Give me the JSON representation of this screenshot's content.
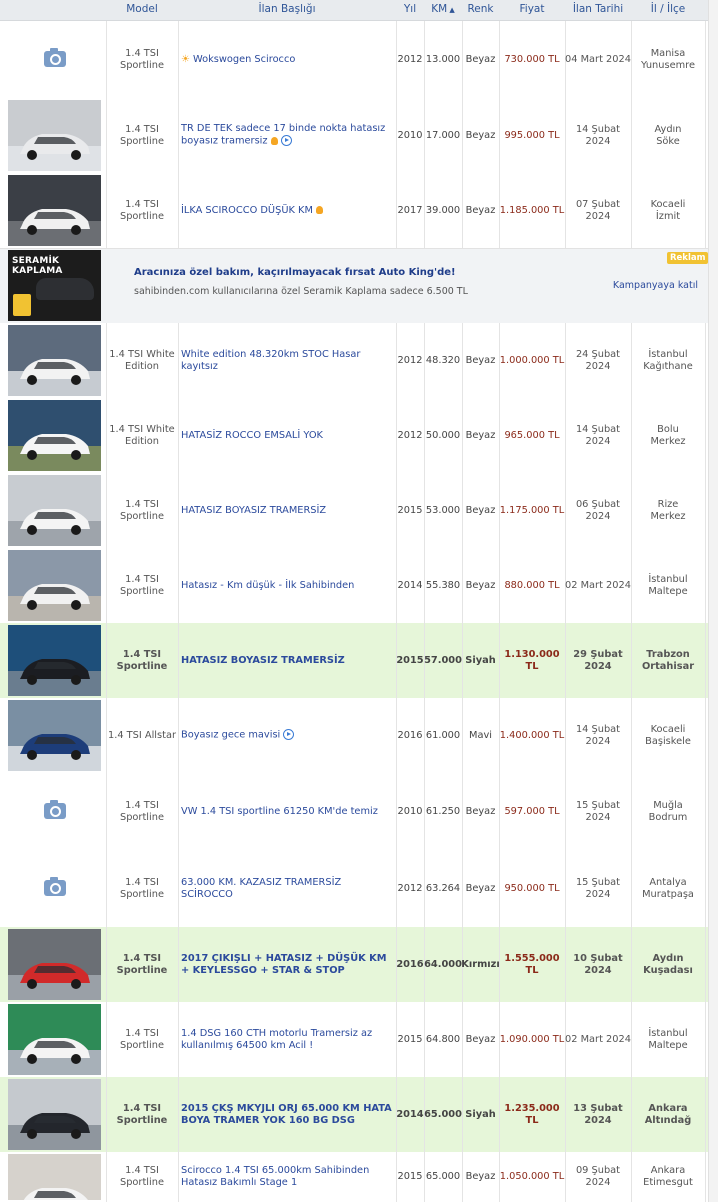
{
  "header": {
    "model": "Model",
    "title": "İlan Başlığı",
    "year": "Yıl",
    "km": "KM",
    "color": "Renk",
    "price": "Fiyat",
    "date": "İlan Tarihi",
    "location": "İl / İlçe"
  },
  "ad": {
    "image_text": "SERAMİK KAPLAMA",
    "title": "Aracınıza özel bakım, kaçırılmayacak fırsat Auto King'de!",
    "subtitle": "sahibinden.com kullanıcılarına özel Seramik Kaplama sadece 6.500 TL",
    "badge": "Reklam",
    "link": "Kampanyaya katıl"
  },
  "listings": [
    {
      "model": "1.4 TSI Sportline",
      "title": "Wokswogen Scirocco",
      "year": "2012",
      "km": "13.000",
      "color": "Beyaz",
      "price": "730.000 TL",
      "date": "04 Mart 2024",
      "city": "Manisa",
      "district": "Yunusemre"
    },
    {
      "model": "1.4 TSI Sportline",
      "title": "TR DE TEK sadece 17 binde nokta hatasız boyasız tramersiz",
      "year": "2010",
      "km": "17.000",
      "color": "Beyaz",
      "price": "995.000 TL",
      "date": "14 Şubat 2024",
      "city": "Aydın",
      "district": "Söke"
    },
    {
      "model": "1.4 TSI Sportline",
      "title": "İLKA SCIROCCO DÜŞÜK KM",
      "year": "2017",
      "km": "39.000",
      "color": "Beyaz",
      "price": "1.185.000 TL",
      "date": "07 Şubat 2024",
      "city": "Kocaeli",
      "district": "İzmit"
    },
    {
      "model": "1.4 TSI White Edition",
      "title": "White edition 48.320km STOC Hasar kayıtsız",
      "year": "2012",
      "km": "48.320",
      "color": "Beyaz",
      "price": "1.000.000 TL",
      "date": "24 Şubat 2024",
      "city": "İstanbul",
      "district": "Kağıthane"
    },
    {
      "model": "1.4 TSI White Edition",
      "title": "HATASİZ ROCCO EMSALİ YOK",
      "year": "2012",
      "km": "50.000",
      "color": "Beyaz",
      "price": "965.000 TL",
      "date": "14 Şubat 2024",
      "city": "Bolu",
      "district": "Merkez"
    },
    {
      "model": "1.4 TSI Sportline",
      "title": "HATASIZ BOYASIZ TRAMERSİZ",
      "year": "2015",
      "km": "53.000",
      "color": "Beyaz",
      "price": "1.175.000 TL",
      "date": "06 Şubat 2024",
      "city": "Rize",
      "district": "Merkez"
    },
    {
      "model": "1.4 TSI Sportline",
      "title": "Hatasız - Km düşük - İlk Sahibinden",
      "year": "2014",
      "km": "55.380",
      "color": "Beyaz",
      "price": "880.000 TL",
      "date": "02 Mart 2024",
      "city": "İstanbul",
      "district": "Maltepe"
    },
    {
      "model": "1.4 TSI Sportline",
      "title": "HATASIZ BOYASIZ TRAMERSİZ",
      "year": "2015",
      "km": "57.000",
      "color": "Siyah",
      "price": "1.130.000 TL",
      "date": "29 Şubat 2024",
      "city": "Trabzon",
      "district": "Ortahisar"
    },
    {
      "model": "1.4 TSI Allstar",
      "title": "Boyasız gece mavisi",
      "year": "2016",
      "km": "61.000",
      "color": "Mavi",
      "price": "1.400.000 TL",
      "date": "14 Şubat 2024",
      "city": "Kocaeli",
      "district": "Başiskele"
    },
    {
      "model": "1.4 TSI Sportline",
      "title": "VW 1.4 TSI sportline 61250 KM'de temiz",
      "year": "2010",
      "km": "61.250",
      "color": "Beyaz",
      "price": "597.000 TL",
      "date": "15 Şubat 2024",
      "city": "Muğla",
      "district": "Bodrum"
    },
    {
      "model": "1.4 TSI Sportline",
      "title": "63.000 KM. KAZASIZ TRAMERSİZ SCİROCCO",
      "year": "2012",
      "km": "63.264",
      "color": "Beyaz",
      "price": "950.000 TL",
      "date": "15 Şubat 2024",
      "city": "Antalya",
      "district": "Muratpaşa"
    },
    {
      "model": "1.4 TSI Sportline",
      "title": "2017 ÇIKIŞLI + HATASIZ + DÜŞÜK KM + KEYLESSGO + STAR & STOP",
      "year": "2016",
      "km": "64.000",
      "color": "Kırmızı",
      "price": "1.555.000 TL",
      "date": "10 Şubat 2024",
      "city": "Aydın",
      "district": "Kuşadası"
    },
    {
      "model": "1.4 TSI Sportline",
      "title": "1.4 DSG 160 CTH motorlu Tramersiz az kullanılmış 64500 km Acil !",
      "year": "2015",
      "km": "64.800",
      "color": "Beyaz",
      "price": "1.090.000 TL",
      "date": "02 Mart 2024",
      "city": "İstanbul",
      "district": "Maltepe"
    },
    {
      "model": "1.4 TSI Sportline",
      "title": "2015 ÇKŞ MKYJLI ORJ 65.000 KM HATA BOYA TRAMER YOK 160 BG DSG",
      "year": "2014",
      "km": "65.000",
      "color": "Siyah",
      "price": "1.235.000 TL",
      "date": "13 Şubat 2024",
      "city": "Ankara",
      "district": "Altındağ"
    },
    {
      "model": "1.4 TSI Sportline",
      "title": "Scirocco 1.4 TSI 65.000km Sahibinden Hatasız Bakımlı Stage 1",
      "year": "2015",
      "km": "65.000",
      "color": "Beyaz",
      "price": "1.050.000 TL",
      "date": "09 Şubat 2024",
      "city": "Ankara",
      "district": "Etimesgut"
    }
  ]
}
